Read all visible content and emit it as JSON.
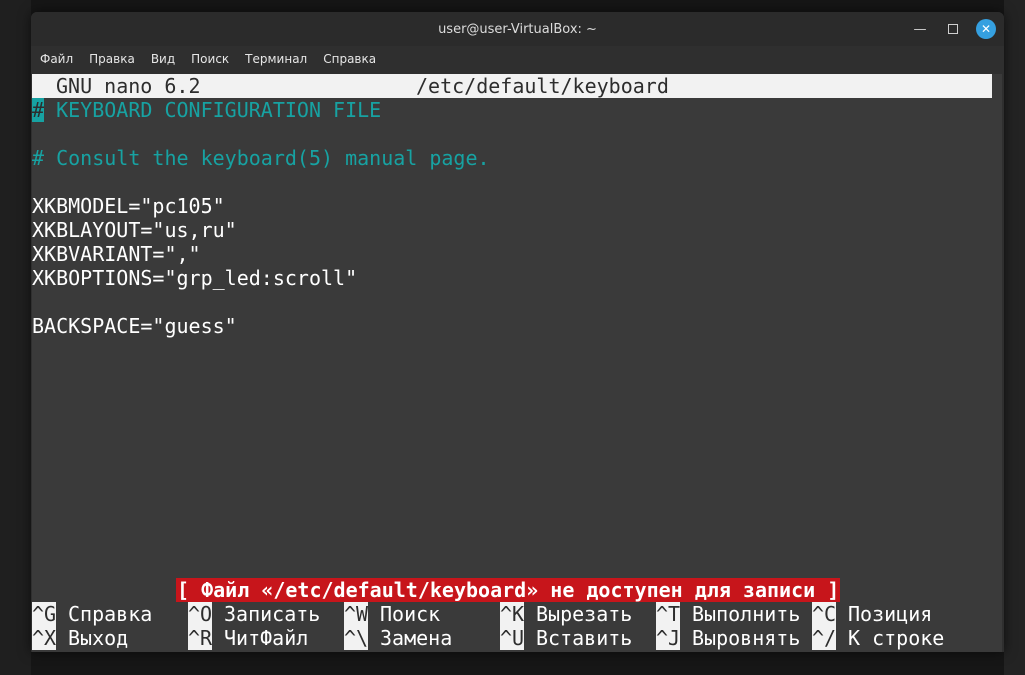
{
  "window": {
    "title": "user@user-VirtualBox: ~"
  },
  "menubar": {
    "items": [
      "Файл",
      "Правка",
      "Вид",
      "Поиск",
      "Терминал",
      "Справка"
    ]
  },
  "nano": {
    "version": "GNU nano 6.2",
    "filename": "/etc/default/keyboard",
    "lines": [
      {
        "text": "# KEYBOARD CONFIGURATION FILE",
        "type": "comment"
      },
      {
        "text": "",
        "type": "blank"
      },
      {
        "text": "# Consult the keyboard(5) manual page.",
        "type": "comment"
      },
      {
        "text": "",
        "type": "blank"
      },
      {
        "text": "XKBMODEL=\"pc105\"",
        "type": "code"
      },
      {
        "text": "XKBLAYOUT=\"us,ru\"",
        "type": "code"
      },
      {
        "text": "XKBVARIANT=\",\"",
        "type": "code"
      },
      {
        "text": "XKBOPTIONS=\"grp_led:scroll\"",
        "type": "code"
      },
      {
        "text": "",
        "type": "blank"
      },
      {
        "text": "BACKSPACE=\"guess\"",
        "type": "code"
      }
    ],
    "status": "[ Файл «/etc/default/keyboard» не доступен для записи ]",
    "shortcuts": [
      [
        {
          "key": "^G",
          "label": "Справка"
        },
        {
          "key": "^O",
          "label": "Записать"
        },
        {
          "key": "^W",
          "label": "Поиск"
        },
        {
          "key": "^K",
          "label": "Вырезать"
        },
        {
          "key": "^T",
          "label": "Выполнить"
        },
        {
          "key": "^C",
          "label": "Позиция"
        }
      ],
      [
        {
          "key": "^X",
          "label": "Выход"
        },
        {
          "key": "^R",
          "label": "ЧитФайл"
        },
        {
          "key": "^\\",
          "label": "Замена"
        },
        {
          "key": "^U",
          "label": "Вставить"
        },
        {
          "key": "^J",
          "label": "Выровнять"
        },
        {
          "key": "^/",
          "label": "К строке"
        }
      ]
    ]
  },
  "colors": {
    "comment": "#17a2a2",
    "status_bg": "#c7151b",
    "close_button": "#35a0e0"
  }
}
